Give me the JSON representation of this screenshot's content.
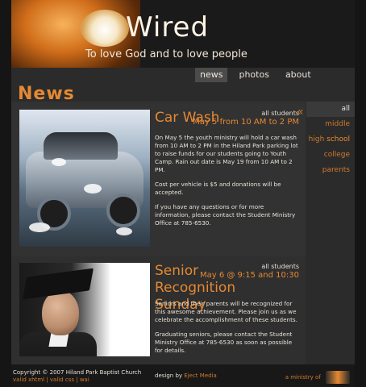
{
  "header": {
    "logo_text": "Wired",
    "tagline": "To love God and to love people",
    "nav": [
      {
        "label": "news",
        "active": true
      },
      {
        "label": "photos",
        "active": false
      },
      {
        "label": "about",
        "active": false
      }
    ]
  },
  "section_title": "News",
  "sidebar": {
    "arrow_icon": "double-chevron-left-icon",
    "items": [
      {
        "label": "all",
        "active": true
      },
      {
        "label": "middle school",
        "active": false
      },
      {
        "label": "high school",
        "active": false
      },
      {
        "label": "college",
        "active": false
      },
      {
        "label": "parents",
        "active": false
      }
    ]
  },
  "articles": [
    {
      "audience": "all students",
      "date": "May 5 from 10 AM to 2 PM",
      "title": "Car Wash",
      "paragraphs": [
        "On May 5 the youth ministry will hold a car wash from 10 AM to 2 PM in the Hiland Park parking lot to raise funds for our students going to Youth Camp. Rain out date is May 19 from 10 AM to 2 PM.",
        "Cost per vehicle is $5 and donations will be accepted.",
        "If you have any questions or for more information, please contact the Student Ministry Office at 785-6530."
      ],
      "image": "car-wash-photo"
    },
    {
      "audience": "all students",
      "date": "May 6 @ 9:15 and 10:30",
      "title": "Senior Recognition Sunday",
      "paragraphs": [
        "Seniors and their parents will be recognized for this awesome achievement. Please join us as we celebrate the accomplishment of these students.",
        "Graduating seniors, please contact the Student Ministry Office at 785-6530 as soon as possible for details."
      ],
      "image": "graduate-photo"
    }
  ],
  "footer": {
    "copyright": "Copyright © 2007 Hiland Park Baptist Church",
    "valid_links": "valid xhtml | valid css | wai",
    "design_prefix": "design by",
    "design_link": "Eject Media",
    "ministry_text": "a ministry of"
  },
  "colors": {
    "accent": "#e58932",
    "background": "#151515",
    "panel": "#343434"
  }
}
